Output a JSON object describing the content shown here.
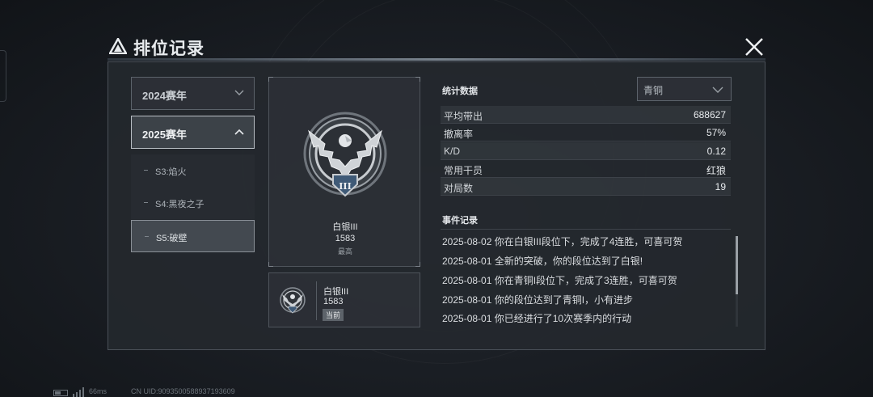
{
  "title": "排位记录",
  "seasons": {
    "years": [
      {
        "label": "2024赛年",
        "expanded": false
      },
      {
        "label": "2025赛年",
        "expanded": true
      }
    ],
    "sub_seasons": [
      {
        "label": "S3:焰火",
        "selected": false
      },
      {
        "label": "S4:黑夜之子",
        "selected": false
      },
      {
        "label": "S5:破壁",
        "selected": true
      }
    ]
  },
  "highest_rank": {
    "name": "白银III",
    "score": "1583",
    "tag": "最高",
    "badge_numeral": "III"
  },
  "current_rank": {
    "name": "白银III",
    "score": "1583",
    "tag": "当前"
  },
  "stats": {
    "title": "统计数据",
    "filter": "青铜",
    "rows": [
      {
        "key": "平均带出",
        "value": "688627"
      },
      {
        "key": "撤离率",
        "value": "57%"
      },
      {
        "key": "K/D",
        "value": "0.12"
      },
      {
        "key": "常用干员",
        "value": "红狼"
      },
      {
        "key": "对局数",
        "value": "19"
      }
    ]
  },
  "events": {
    "title": "事件记录",
    "items": [
      "2025-08-02 你在白银III段位下，完成了4连胜，可喜可贺",
      "2025-08-01 全新的突破，你的段位达到了白银!",
      "2025-08-01 你在青铜I段位下，完成了3连胜，可喜可贺",
      "2025-08-01 你的段位达到了青铜I，小有进步",
      "2025-08-01 你已经进行了10次赛季内的行动"
    ],
    "scroll_position": 0.0
  },
  "footer": {
    "ping": "66ms",
    "uid": "CN UID:9093500588937193609"
  },
  "colors": {
    "background": "#1b1f25",
    "panel": "#24282e",
    "accent_silver": "#c8ccd0",
    "text": "#d6dade"
  },
  "icons": {
    "title": "logo-triangle-icon",
    "close": "close-icon",
    "rank_badge": "eagle-badge-icon"
  }
}
